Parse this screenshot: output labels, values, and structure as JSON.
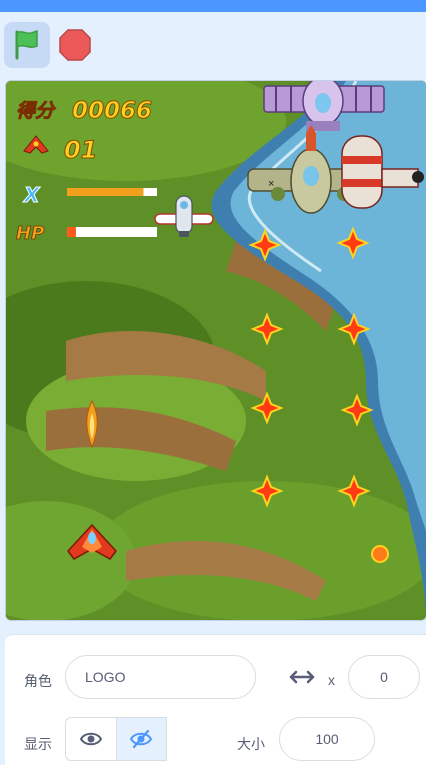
{
  "hud": {
    "score_label": "得分",
    "score_value": "00066",
    "lives_value": "01",
    "bomb_label": "X",
    "hp_label": "HP",
    "bomb_level": 0.85,
    "hp_level": 0.1
  },
  "sprite_panel": {
    "sprite_label": "角色",
    "sprite_name": "LOGO",
    "x_label": "x",
    "x_value": "0",
    "show_label": "显示",
    "size_label": "大小",
    "size_value": "100"
  },
  "colors": {
    "accent": "#4c97ff",
    "flag": "#4cbf56",
    "stop": "#ec5959",
    "score": "#ffd21f"
  },
  "icons": {
    "green_flag": "green-flag-icon",
    "stop": "stop-icon",
    "xy": "arrows-icon",
    "show": "eye-icon",
    "hide": "eye-slash-icon"
  }
}
